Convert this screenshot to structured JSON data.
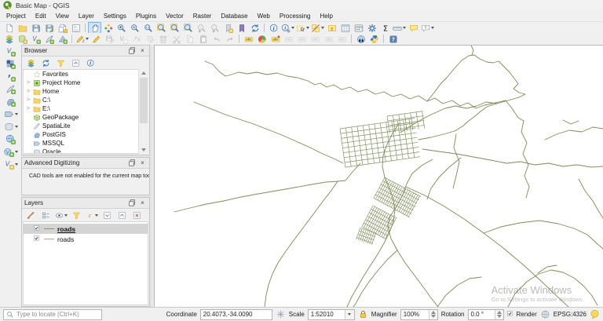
{
  "window": {
    "title": "Basic Map - QGIS"
  },
  "menu": {
    "items": [
      "Project",
      "Edit",
      "View",
      "Layer",
      "Settings",
      "Plugins",
      "Vector",
      "Raster",
      "Database",
      "Web",
      "Processing",
      "Help"
    ]
  },
  "toolbars": {
    "row1": [
      {
        "name": "new-project",
        "sym": "page"
      },
      {
        "name": "open-project",
        "sym": "folder"
      },
      {
        "name": "save-project",
        "sym": "floppy"
      },
      {
        "name": "save-project-as",
        "sym": "floppy-edit"
      },
      {
        "name": "new-print-layout",
        "sym": "page-copy"
      },
      {
        "name": "show-layout-manager",
        "sym": "layout"
      },
      {
        "sep": true
      },
      {
        "name": "pan-map",
        "sym": "hand",
        "active": true
      },
      {
        "name": "pan-to-selection",
        "sym": "diamonds"
      },
      {
        "name": "zoom-in",
        "sym": "mag-plus"
      },
      {
        "name": "zoom-out",
        "sym": "mag-minus"
      },
      {
        "name": "zoom-native",
        "sym": "mag-native"
      },
      {
        "name": "zoom-full-extent",
        "sym": "mag-full"
      },
      {
        "name": "zoom-to-selection",
        "sym": "mag-sel"
      },
      {
        "name": "zoom-to-layer",
        "sym": "mag-layer"
      },
      {
        "name": "zoom-last",
        "sym": "mag-last",
        "dis": true
      },
      {
        "name": "zoom-next",
        "sym": "mag-next",
        "dis": true
      },
      {
        "name": "new-spatial-bookmark",
        "sym": "bookmark-add"
      },
      {
        "name": "show-bookmarks",
        "sym": "bookmark"
      },
      {
        "name": "refresh-map",
        "sym": "refresh"
      },
      {
        "sep": true
      },
      {
        "name": "identify-features",
        "sym": "info"
      },
      {
        "name": "run-feature-action",
        "sym": "info-gear",
        "dd": true
      },
      {
        "name": "select-features",
        "sym": "select-rect",
        "dd": true
      },
      {
        "name": "deselect-features",
        "sym": "deselect",
        "dd": true
      },
      {
        "name": "select-by-expression",
        "sym": "select-expr"
      },
      {
        "name": "open-attribute-table",
        "sym": "table"
      },
      {
        "name": "field-calculator",
        "sym": "calc"
      },
      {
        "name": "processing-toolbox",
        "sym": "cog"
      },
      {
        "name": "statistical-summary",
        "sym": "sigma"
      },
      {
        "name": "measure-line",
        "sym": "ruler",
        "dd": true
      },
      {
        "name": "map-tips",
        "sym": "balloon"
      },
      {
        "name": "text-annotation",
        "sym": "annotation",
        "dd": true
      }
    ],
    "row2": [
      {
        "name": "open-data-source-manager",
        "sym": "layers-add"
      },
      {
        "name": "new-geopackage-layer",
        "sym": "db-add"
      },
      {
        "name": "new-shapefile-layer",
        "sym": "vlayer-add"
      },
      {
        "name": "new-spatialite-layer",
        "sym": "pen-add"
      },
      {
        "name": "new-mesh-layer",
        "sym": "mesh-add"
      },
      {
        "sep": true
      },
      {
        "name": "current-edits",
        "sym": "pencil-dots",
        "dd": true
      },
      {
        "name": "toggle-editing",
        "sym": "pencil"
      },
      {
        "name": "save-layer-edits",
        "sym": "floppy-pencil",
        "dis": true
      },
      {
        "name": "add-line-feature",
        "sym": "vdigitize",
        "dis": true
      },
      {
        "name": "vertex-tool",
        "sym": "vertex",
        "dis": true
      },
      {
        "name": "modify-attributes",
        "sym": "multiedit",
        "dis": true
      },
      {
        "name": "delete-selected",
        "sym": "trash",
        "dis": true
      },
      {
        "name": "cut-features",
        "sym": "scissors",
        "dis": true
      },
      {
        "name": "copy-features",
        "sym": "copy",
        "dis": true
      },
      {
        "name": "paste-features",
        "sym": "paste",
        "dis": true
      },
      {
        "name": "undo",
        "sym": "undo",
        "dis": true
      },
      {
        "name": "redo",
        "sym": "redo",
        "dis": true
      },
      {
        "sep": true
      },
      {
        "name": "layer-labeling-options",
        "sym": "label-abc"
      },
      {
        "name": "layer-diagram-options",
        "sym": "diagram"
      },
      {
        "name": "highlight-pinned-labels",
        "sym": "label-pin"
      },
      {
        "name": "pin-unpin-labels",
        "sym": "label-grey",
        "dis": true
      },
      {
        "name": "show-hide-labels",
        "sym": "label-grey",
        "dis": true
      },
      {
        "name": "move-label",
        "sym": "label-grey",
        "dis": true
      },
      {
        "name": "rotate-label",
        "sym": "label-grey",
        "dis": true
      },
      {
        "name": "change-label-properties",
        "sym": "label-grey",
        "dis": true
      },
      {
        "sep": true
      },
      {
        "name": "metasearch",
        "sym": "metasearch"
      },
      {
        "name": "python-console",
        "sym": "python"
      },
      {
        "sep": true
      },
      {
        "name": "help-contents",
        "sym": "help"
      }
    ],
    "left": [
      {
        "name": "add-vector-layer",
        "sym": "vlayer-add"
      },
      {
        "name": "add-raster-layer",
        "sym": "raster-add"
      },
      {
        "name": "add-delimited-text-layer",
        "sym": "comma-add"
      },
      {
        "name": "add-spatialite-layer",
        "sym": "pen-add"
      },
      {
        "name": "add-postgis-layer",
        "sym": "postgis-add"
      },
      {
        "name": "add-mssql-layer",
        "sym": "db-blue",
        "dd": true
      },
      {
        "name": "add-oracle-layer",
        "sym": "oracle-db",
        "dd": true
      },
      {
        "name": "add-wms-layer",
        "sym": "globe-add"
      },
      {
        "name": "add-wfs-layer",
        "sym": "vglobe-add",
        "dd": true
      },
      {
        "name": "add-virtual-layer",
        "sym": "vlayer-virtual",
        "dd": true
      }
    ]
  },
  "browser_panel": {
    "title": "Browser",
    "tools": [
      {
        "name": "add-selected-layers",
        "sym": "layers-add"
      },
      {
        "name": "refresh-browser",
        "sym": "refresh"
      },
      {
        "name": "filter-browser",
        "sym": "funnel"
      },
      {
        "name": "collapse-all",
        "sym": "collapse"
      },
      {
        "name": "enable-properties-widget",
        "sym": "info"
      }
    ],
    "items": [
      {
        "label": "Favorites",
        "sym": "star",
        "arrow": false
      },
      {
        "label": "Project Home",
        "sym": "home-proj",
        "arrow": true
      },
      {
        "label": "Home",
        "sym": "folder",
        "arrow": true
      },
      {
        "label": "C:\\",
        "sym": "folder",
        "arrow": true
      },
      {
        "label": "E:\\",
        "sym": "folder",
        "arrow": true
      },
      {
        "label": "GeoPackage",
        "sym": "geopackage",
        "arrow": false
      },
      {
        "label": "SpatiaLite",
        "sym": "spatialite",
        "arrow": false
      },
      {
        "label": "PostGIS",
        "sym": "postgis",
        "arrow": false
      },
      {
        "label": "MSSQL",
        "sym": "mssql",
        "arrow": false
      },
      {
        "label": "Oracle",
        "sym": "oracle",
        "arrow": false
      }
    ]
  },
  "advanced_digitizing_panel": {
    "title": "Advanced Digitizing",
    "message": "CAD tools are not enabled for the current map tool"
  },
  "layers_panel": {
    "title": "Layers",
    "tools": [
      {
        "name": "open-layer-styling",
        "sym": "brush"
      },
      {
        "name": "add-group",
        "sym": "group"
      },
      {
        "name": "manage-map-themes",
        "sym": "eye",
        "dd": true
      },
      {
        "name": "filter-legend",
        "sym": "funnel"
      },
      {
        "name": "filter-by-expression",
        "sym": "expr",
        "dd": true
      },
      {
        "name": "expand-all",
        "sym": "expand"
      },
      {
        "name": "collapse-all-layers",
        "sym": "collapse"
      },
      {
        "name": "remove-layer",
        "sym": "remove"
      }
    ],
    "items": [
      {
        "label": "roads",
        "checked": true,
        "selected": true,
        "symbol_color": "#8a9470"
      },
      {
        "label": "roads",
        "checked": true,
        "selected": false,
        "symbol_color": "#c79f9f"
      }
    ]
  },
  "map": {
    "road_color": "#75854f",
    "watermark_title": "Activate Windows",
    "watermark_subtitle": "Go to Settings to activate Windows."
  },
  "status": {
    "locate_placeholder": "Type to locate (Ctrl+K)",
    "coordinate_label": "Coordinate",
    "coordinate_value": "20.4073,-34.0090",
    "scale_label": "Scale",
    "scale_value": "1:52010",
    "magnifier_label": "Magnifier",
    "magnifier_value": "100%",
    "rotation_label": "Rotation",
    "rotation_value": "0.0 °",
    "render_label": "Render",
    "render_checked": true,
    "crs": "EPSG:4326"
  }
}
